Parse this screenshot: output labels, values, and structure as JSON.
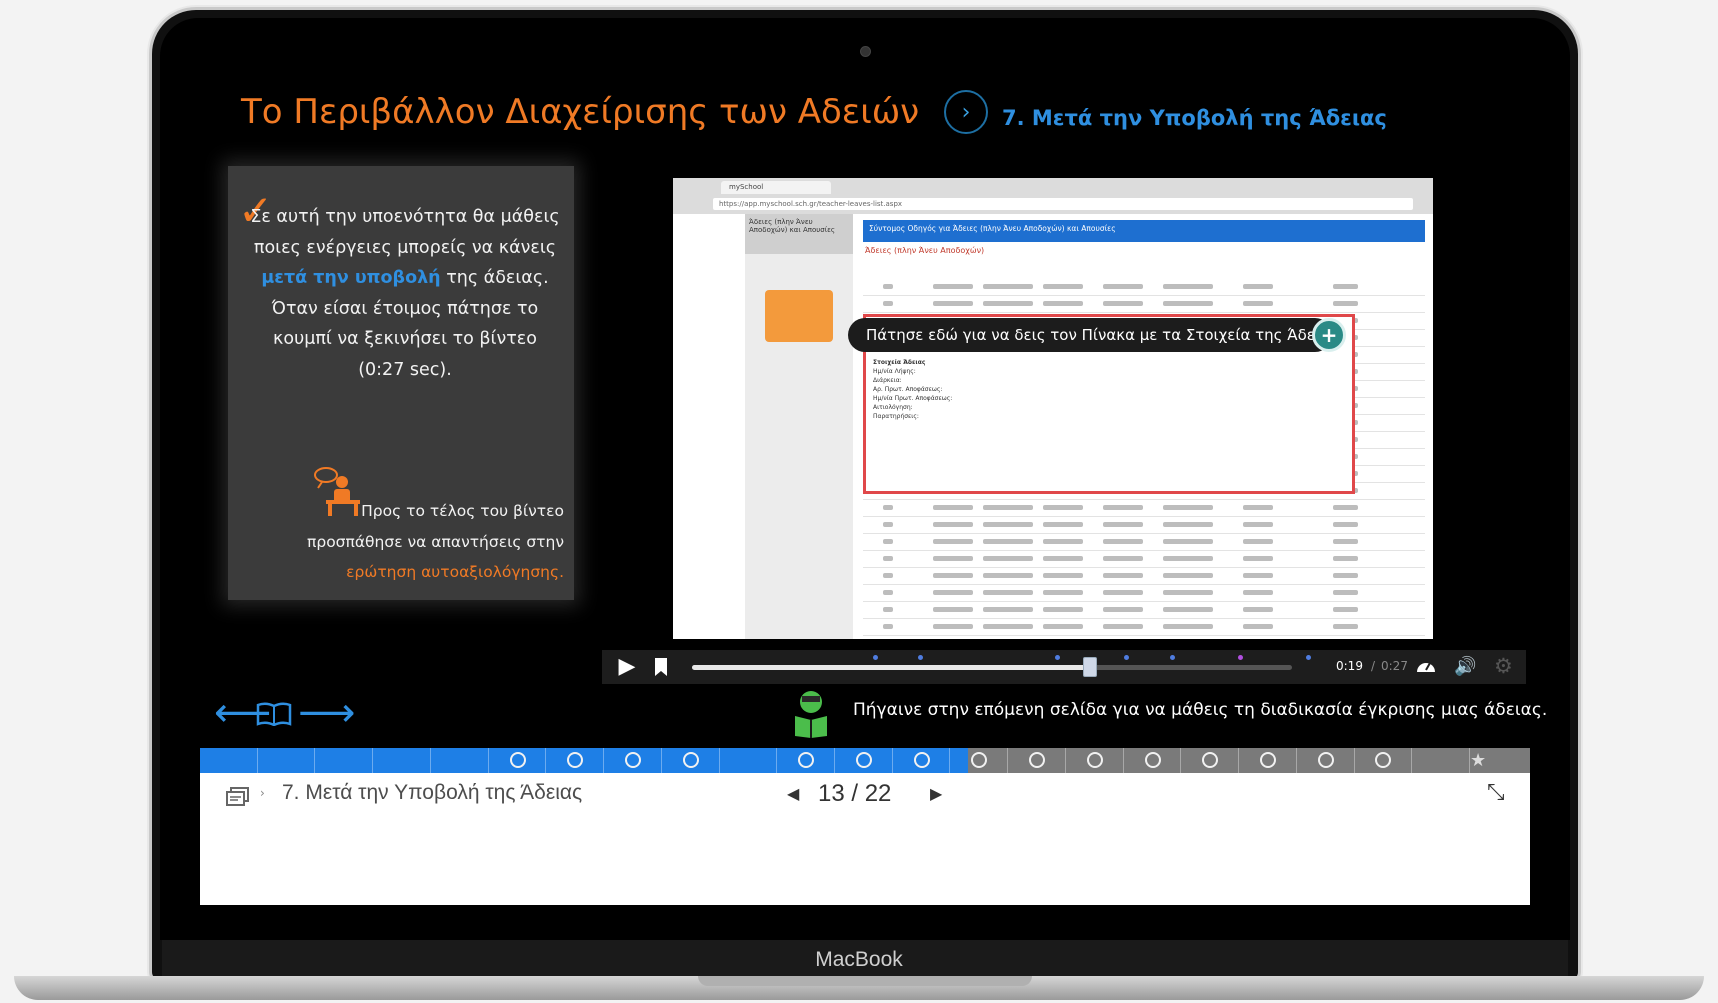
{
  "header": {
    "title": "Το Περιβάλλον Διαχείρισης των Αδειών",
    "arrow": "›",
    "section": "7. Μετά την Υποβολή της Άδειας"
  },
  "intro": {
    "check": "✓",
    "line1": "Σε αυτή την υποενότητα θα μάθεις ποιες ενέργειες μπορείς να κάνεις",
    "highlight": "μετά την υποβολή",
    "line2": " της άδειας. Όταν είσαι έτοιμος πάτησε το κουμπί να ξεκινήσει το βίντεο (0:27 sec)."
  },
  "tip": {
    "text": "Προς το τέλος του βίντεο προσπάθησε να απαντήσεις στην",
    "link": "ερώτηση αυτοαξιολόγησης."
  },
  "video": {
    "tab": "mySchool",
    "url": "https://app.myschool.sch.gr/teacher-leaves-list.aspx",
    "side_nav": "Άδειες (πλην Άνευ Αποδοχών) και Απουσίες",
    "header": "Σύντομος Οδηγός για Άδειες (πλην Άνευ Αποδοχών) και Απουσίες",
    "subheader": "Άδειες (πλην Άνευ Αποδοχών)",
    "tooltip": "Πάτησε εδώ για να δεις τον Πίνακα με τα Στοιχεία της Άδειας.",
    "plus": "+",
    "doc_lines": [
      "Στοιχεία Άδειας",
      "Ημ/νία Λήψης:",
      "Διάρκεια:",
      "Αρ. Πρωτ. Αποφάσεως:",
      "Ημ/νία Πρωτ. Αποφάσεως:",
      "Αιτιολόγηση:",
      "Παρατηρήσεις:"
    ]
  },
  "player": {
    "play": "▶",
    "time_current": "0:19",
    "time_sep": "/",
    "time_duration": "0:27",
    "progress": 0.662,
    "speed_icon": "speedometer-icon",
    "volume": "🔊",
    "settings": "⚙"
  },
  "nav": {
    "prev": "⟵",
    "next": "⟶",
    "next_message": "Πήγαινε στην επόμενη σελίδα για να μάθεις τη διαδικασία έγκρισης μιας άδειας."
  },
  "progress_bar": {
    "completed_color": "#1e7fe6",
    "remaining_color": "#7a7a7a",
    "total_segments": 22,
    "completed_segments": 13,
    "star": "★"
  },
  "footer": {
    "crumb_arrow": "›",
    "breadcrumb": "7. Μετά την Υποβολή της Άδειας",
    "page_prev": "◀",
    "page_current": "13 / 22",
    "page_next": "▶",
    "fullscreen": "⤡"
  },
  "device": {
    "brand": "MacBook"
  }
}
